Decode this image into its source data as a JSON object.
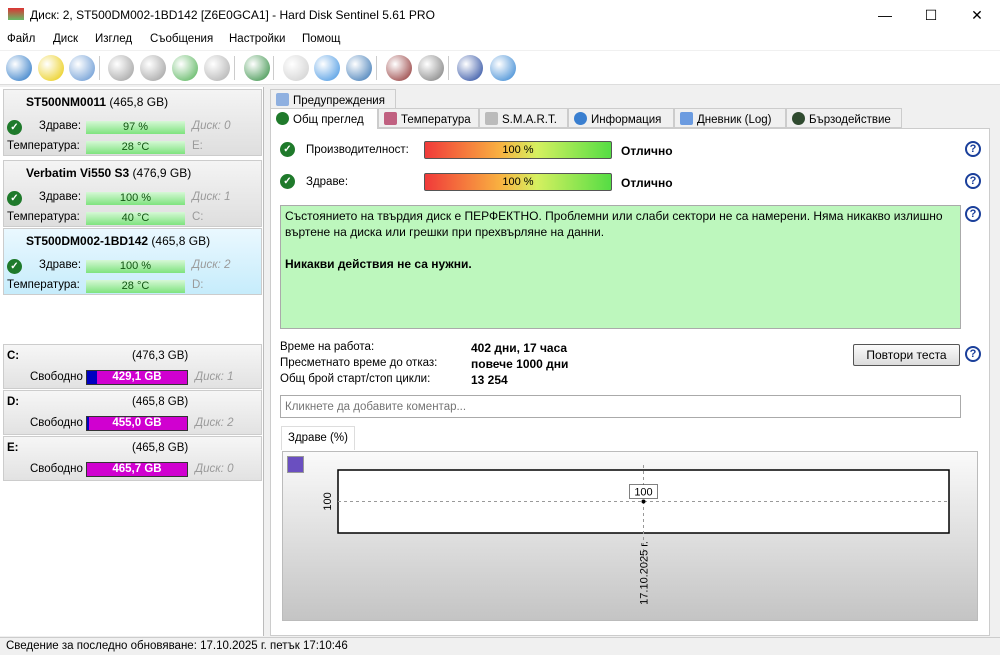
{
  "window": {
    "title": "Диск: 2, ST500DM002-1BD142 [Z6E0GCA1]  -  Hard Disk Sentinel 5.61 PRO",
    "minimize": "—",
    "maximize": "☐",
    "close": "✕"
  },
  "menu": [
    "Файл",
    "Диск",
    "Изглед",
    "Съобщения",
    "Настройки",
    "Помощ"
  ],
  "toolbar": [
    {
      "icon": "refresh-icon",
      "color": "#1e6fc2"
    },
    {
      "icon": "alert-icon",
      "color": "#e8c800"
    },
    {
      "icon": "disk-info-icon",
      "color": "#5a8fcf"
    },
    {
      "icon": "disk-test-icon",
      "color": "#999999"
    },
    {
      "icon": "disk-time-icon",
      "color": "#999999"
    },
    {
      "icon": "disk-ok-icon",
      "color": "#4caf50"
    },
    {
      "icon": "disk-search-icon",
      "color": "#aaaaaa"
    },
    {
      "icon": "network-disk-icon",
      "color": "#2c8a3c"
    },
    {
      "icon": "report-icon",
      "color": "#cccccc"
    },
    {
      "icon": "sync-icon",
      "color": "#3a8fe0"
    },
    {
      "icon": "network-icon",
      "color": "#2f6fb0"
    },
    {
      "icon": "monitor-icon",
      "color": "#8b2a2a"
    },
    {
      "icon": "speaker-icon",
      "color": "#777777"
    },
    {
      "icon": "help-icon",
      "color": "#1a3f9a"
    },
    {
      "icon": "info-icon",
      "color": "#2a7fd0"
    }
  ],
  "disks": [
    {
      "name": "ST500NM0011",
      "size": "(465,8 GB)",
      "health_label": "Здраве:",
      "health": "97 %",
      "temp_label": "Температура:",
      "temp": "28 °C",
      "disk": "Диск: 0",
      "drive": "E:",
      "selected": false
    },
    {
      "name": "Verbatim Vi550 S3",
      "size": "(476,9 GB)",
      "health_label": "Здраве:",
      "health": "100 %",
      "temp_label": "Температура:",
      "temp": "40 °C",
      "disk": "Диск: 1",
      "drive": "C:",
      "selected": false
    },
    {
      "name": "ST500DM002-1BD142",
      "size": "(465,8 GB)",
      "health_label": "Здраве:",
      "health": "100 %",
      "temp_label": "Температура:",
      "temp": "28 °C",
      "disk": "Диск: 2",
      "drive": "D:",
      "selected": true
    }
  ],
  "partitions": [
    {
      "drive": "C:",
      "size": "(476,3 GB)",
      "free_label": "Свободно",
      "free": "429,1 GB",
      "used_fraction": 0.1,
      "disk": "Диск: 1"
    },
    {
      "drive": "D:",
      "size": "(465,8 GB)",
      "free_label": "Свободно",
      "free": "455,0 GB",
      "used_fraction": 0.02,
      "disk": "Диск: 2"
    },
    {
      "drive": "E:",
      "size": "(465,8 GB)",
      "free_label": "Свободно",
      "free": "465,7 GB",
      "used_fraction": 0.0,
      "disk": "Диск: 0"
    }
  ],
  "tabs": {
    "warnings": "Предупреждения",
    "overview": "Общ преглед",
    "temperature": "Температура",
    "smart": "S.M.A.R.T.",
    "information": "Информация",
    "log": "Дневник (Log)",
    "performance": "Бързодействие"
  },
  "overview": {
    "performance_label": "Производителност:",
    "performance_value": "100 %",
    "performance_rating": "Отлично",
    "health_label": "Здраве:",
    "health_value": "100 %",
    "health_rating": "Отлично",
    "message": "Състоянието на твърдия диск е ПЕРФЕКТНО. Проблемни или слаби сектори не са намерени. Няма никакво излишно въртене на диска или грешки при прехвърляне на данни.",
    "message_action": "Никакви действия не са нужни.",
    "uptime_label": "Време на работа:",
    "uptime": "402 дни, 17 часа",
    "lifetime_label": "Пресметнато време до отказ:",
    "lifetime": "повече 1000 дни",
    "cycles_label": "Общ брой старт/стоп цикли:",
    "cycles": "13 254",
    "retest": "Повтори теста",
    "comment_placeholder": "Кликнете да добавите коментар...",
    "help": "?"
  },
  "chart_data": {
    "type": "line",
    "tab": "Здраве (%)",
    "x": [
      "17.10.2025 г."
    ],
    "values": [
      100
    ],
    "data_labels": [
      "100"
    ],
    "y_ticks": [
      "100"
    ],
    "grid": true
  },
  "status": "Сведение за последно обновяване: 17.10.2025 г. петък 17:10:46"
}
